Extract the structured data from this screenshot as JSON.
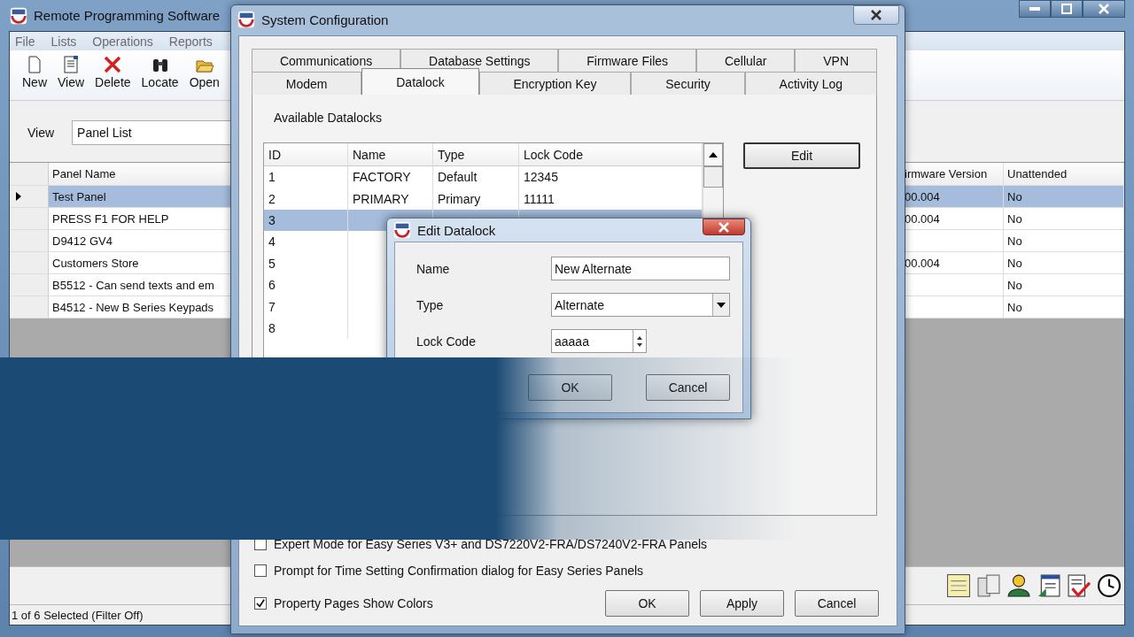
{
  "main_window": {
    "title": "Remote Programming Software",
    "menu": [
      "File",
      "Lists",
      "Operations",
      "Reports"
    ],
    "toolbar": [
      {
        "kind": "new",
        "label": "New"
      },
      {
        "kind": "view",
        "label": "View"
      },
      {
        "kind": "delete",
        "label": "Delete"
      },
      {
        "kind": "locate",
        "label": "Locate"
      },
      {
        "kind": "open",
        "label": "Open"
      }
    ],
    "view_label": "View",
    "view_value": "Panel List",
    "grid": {
      "columns": [
        "Panel Name",
        "irmware Version",
        "Unattended"
      ],
      "rows": [
        {
          "name": "Test Panel",
          "firmware": "00.004",
          "unattended": "No",
          "selected": true
        },
        {
          "name": "PRESS F1 FOR HELP",
          "firmware": "00.004",
          "unattended": "No",
          "selected": false
        },
        {
          "name": "D9412 GV4",
          "unattended": "No",
          "selected": false
        },
        {
          "name": "Customers Store",
          "firmware": "00.004",
          "unattended": "No",
          "selected": false
        },
        {
          "name": "B5512 - Can send texts and em",
          "unattended": "No",
          "selected": false
        },
        {
          "name": "B4512 - New B Series Keypads",
          "unattended": "No",
          "selected": false
        }
      ]
    },
    "status": "1 of 6 Selected (Filter Off)"
  },
  "system_configuration": {
    "title": "System Configuration",
    "tab_rows": [
      [
        {
          "label": "Communications",
          "selected": false
        },
        {
          "label": "Database Settings",
          "selected": false
        },
        {
          "label": "Firmware Files",
          "selected": false
        },
        {
          "label": "Cellular",
          "selected": false
        },
        {
          "label": "VPN",
          "selected": false
        }
      ],
      [
        {
          "label": "Modem",
          "selected": false
        },
        {
          "label": "Datalock",
          "selected": true
        },
        {
          "label": "Encryption Key",
          "selected": false
        },
        {
          "label": "Security",
          "selected": false
        },
        {
          "label": "Activity Log",
          "selected": false
        }
      ]
    ],
    "section_label": "Available Datalocks",
    "table": {
      "columns": [
        "ID",
        "Name",
        "Type",
        "Lock Code"
      ],
      "rows": [
        {
          "id": "1",
          "name": "FACTORY",
          "type": "Default",
          "code": "12345",
          "selected": false
        },
        {
          "id": "2",
          "name": "PRIMARY",
          "type": "Primary",
          "code": "11111",
          "selected": false
        },
        {
          "id": "3",
          "selected": true
        },
        {
          "id": "4",
          "selected": false
        },
        {
          "id": "5",
          "selected": false
        },
        {
          "id": "6",
          "selected": false
        },
        {
          "id": "7",
          "selected": false
        },
        {
          "id": "8",
          "selected": false
        }
      ]
    },
    "edit_button": "Edit",
    "options": [
      {
        "label": "Expert Mode for Easy Series V3+ and DS7220V2-FRA/DS7240V2-FRA Panels",
        "checked": false
      },
      {
        "label": "Prompt for Time Setting Confirmation dialog for Easy Series Panels",
        "checked": false
      },
      {
        "label": "Property Pages Show Colors",
        "checked": true
      }
    ],
    "buttons": [
      "OK",
      "Apply",
      "Cancel"
    ]
  },
  "edit_datalock": {
    "title": "Edit Datalock",
    "name_label": "Name",
    "name_value": "New Alternate",
    "type_label": "Type",
    "type_value": "Alternate",
    "code_label": "Lock Code",
    "code_value": "aaaaa",
    "buttons": [
      "OK",
      "Cancel"
    ]
  }
}
